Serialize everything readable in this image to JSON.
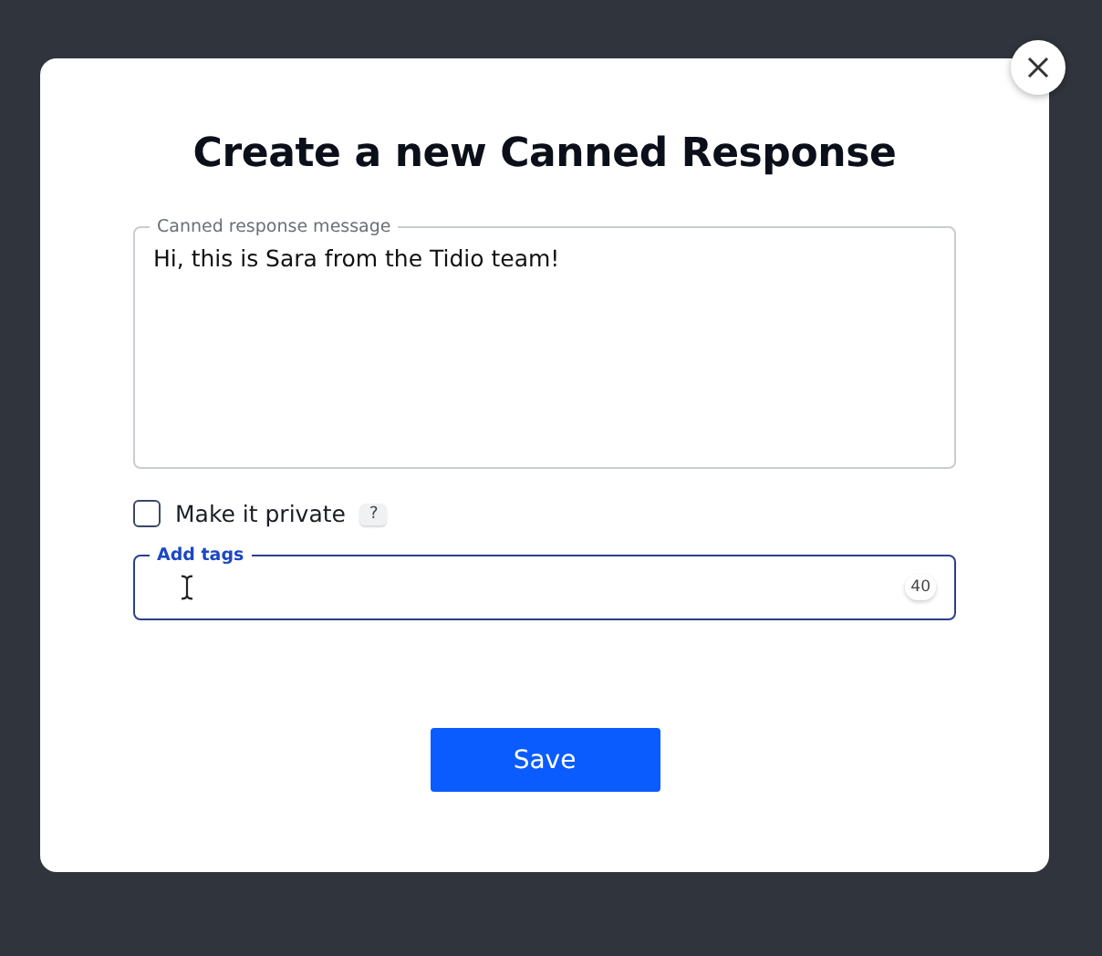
{
  "dialog": {
    "title": "Create a new Canned Response"
  },
  "message": {
    "label": "Canned response message",
    "value": "Hi, this is Sara from the Tidio team!"
  },
  "private_option": {
    "label": "Make it private",
    "checked": false,
    "help": "?"
  },
  "tags": {
    "label": "Add tags",
    "counter": "40",
    "focused": true
  },
  "buttons": [
    "Save"
  ]
}
